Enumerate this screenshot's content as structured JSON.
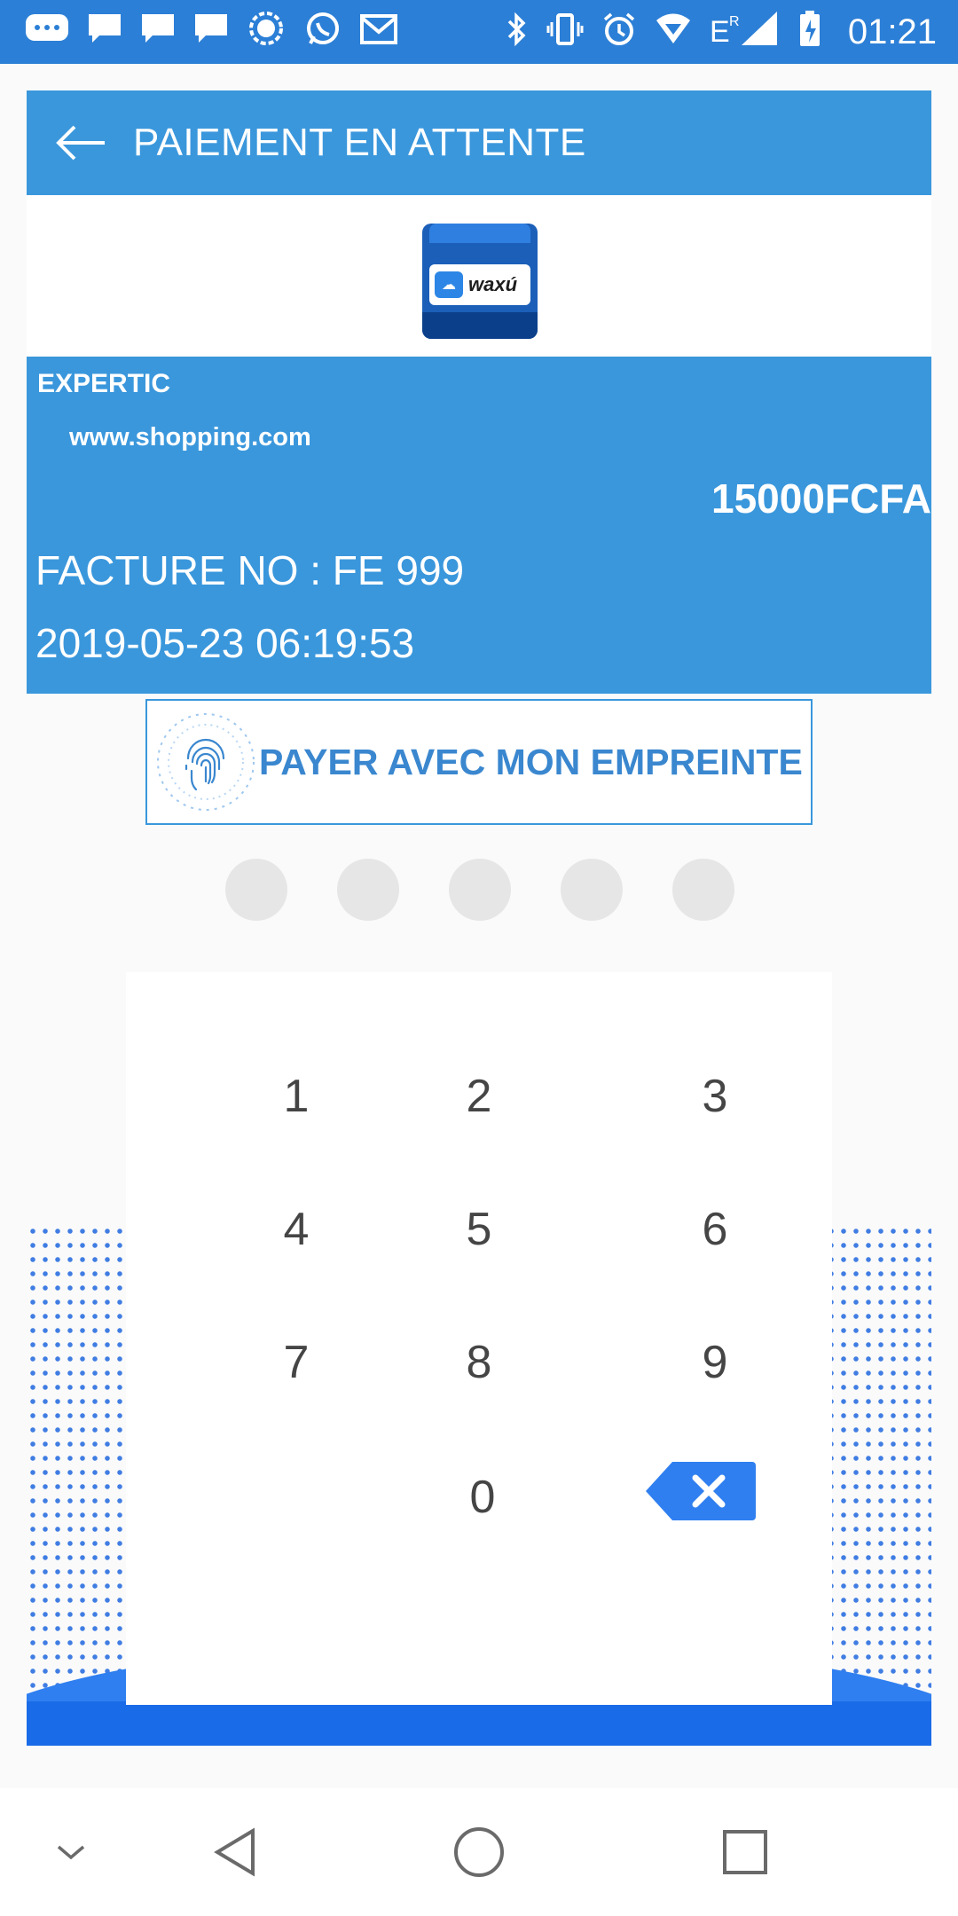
{
  "status_bar": {
    "time": "01:21",
    "icons_left": [
      "messenger-icon",
      "message-icon",
      "message-icon",
      "message-icon",
      "signal-icon",
      "whatsapp-icon",
      "gmail-icon"
    ],
    "icons_right": [
      "bluetooth-icon",
      "vibrate-icon",
      "alarm-icon",
      "wifi-icon",
      "cell-signal-icon",
      "battery-icon"
    ]
  },
  "toolbar": {
    "title": "PAIEMENT EN ATTENTE",
    "back_icon": "arrow-left-icon"
  },
  "logo": {
    "brand_text": "waxú"
  },
  "invoice": {
    "merchant": "EXPERTIC",
    "website": "www.shopping.com",
    "amount": "15000FCFA",
    "number_line": "FACTURE NO : FE 999",
    "datetime": "2019-05-23 06:19:53"
  },
  "fingerprint_button": {
    "label": "PAYER AVEC MON EMPREINTE",
    "icon": "fingerprint-icon"
  },
  "pin": {
    "dot_count": 5,
    "filled": 0
  },
  "keypad": {
    "keys": [
      "1",
      "2",
      "3",
      "4",
      "5",
      "6",
      "7",
      "8",
      "9",
      "0"
    ],
    "backspace_icon": "backspace-icon"
  },
  "nav_bar": {
    "icons": [
      "chevron-down-icon",
      "back-triangle-icon",
      "home-circle-icon",
      "recents-square-icon"
    ]
  },
  "colors": {
    "status_bar": "#2c7fd6",
    "primary": "#3a97dc",
    "accent_blue": "#2f7ff0",
    "pin_dot": "#e6e6e6"
  }
}
